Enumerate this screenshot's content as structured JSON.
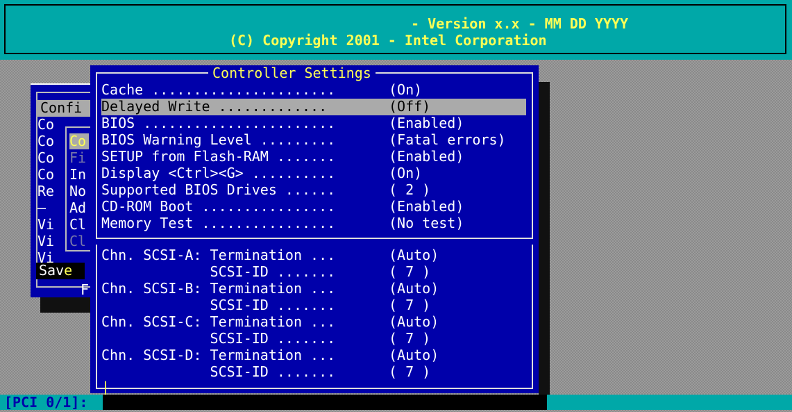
{
  "header": {
    "version_line": "- Version x.x - MM DD YYYY",
    "copyright_line": "(C) Copyright 2001 - Intel Corporation"
  },
  "background_menu": {
    "title_item": "Confi",
    "items": [
      "Co",
      "Co",
      "Co",
      "Co",
      "Re",
      "—",
      "Vi",
      "Vi",
      "Vi"
    ],
    "save_prefix": "Sav",
    "save_hotkey": "e",
    "footer": "F"
  },
  "submenu": {
    "items": [
      "Co",
      "Fi",
      "In",
      "No",
      "Ad",
      "Cl",
      "Cl"
    ]
  },
  "dialog": {
    "title": "Controller Settings",
    "settings": [
      {
        "label": "Cache ......................",
        "value": "(On)"
      },
      {
        "label": "Delayed Write .............",
        "value": "(Off)"
      },
      {
        "label": "BIOS .......................",
        "value": "(Enabled)"
      },
      {
        "label": "BIOS Warning Level .........",
        "value": "(Fatal errors)"
      },
      {
        "label": "SETUP from Flash-RAM .......",
        "value": "(Enabled)"
      },
      {
        "label": "Display <Ctrl><G> ..........",
        "value": "(On)"
      },
      {
        "label": "Supported BIOS Drives ......",
        "value": "( 2 )"
      },
      {
        "label": "CD-ROM Boot ................",
        "value": "(Enabled)"
      },
      {
        "label": "Memory Test ................",
        "value": "(No test)"
      }
    ],
    "channels": [
      {
        "label": "Chn. SCSI-A: Termination ...",
        "value": "(Auto)"
      },
      {
        "label": "             SCSI-ID .......",
        "value": "( 7 )"
      },
      {
        "label": "Chn. SCSI-B: Termination ...",
        "value": "(Auto)"
      },
      {
        "label": "             SCSI-ID .......",
        "value": "( 7 )"
      },
      {
        "label": "Chn. SCSI-C: Termination ...",
        "value": "(Auto)"
      },
      {
        "label": "             SCSI-ID .......",
        "value": "( 7 )"
      },
      {
        "label": "Chn. SCSI-D: Termination ...",
        "value": "(Auto)"
      },
      {
        "label": "             SCSI-ID .......",
        "value": "( 7 )"
      }
    ],
    "cursor": "|"
  },
  "status_bar": {
    "text": "[PCI 0/1]:"
  },
  "colors": {
    "bios_blue": "#0000aa",
    "teal": "#00a8a8",
    "highlight_yellow": "#ffff55",
    "selection_gray": "#aaaaaa"
  }
}
